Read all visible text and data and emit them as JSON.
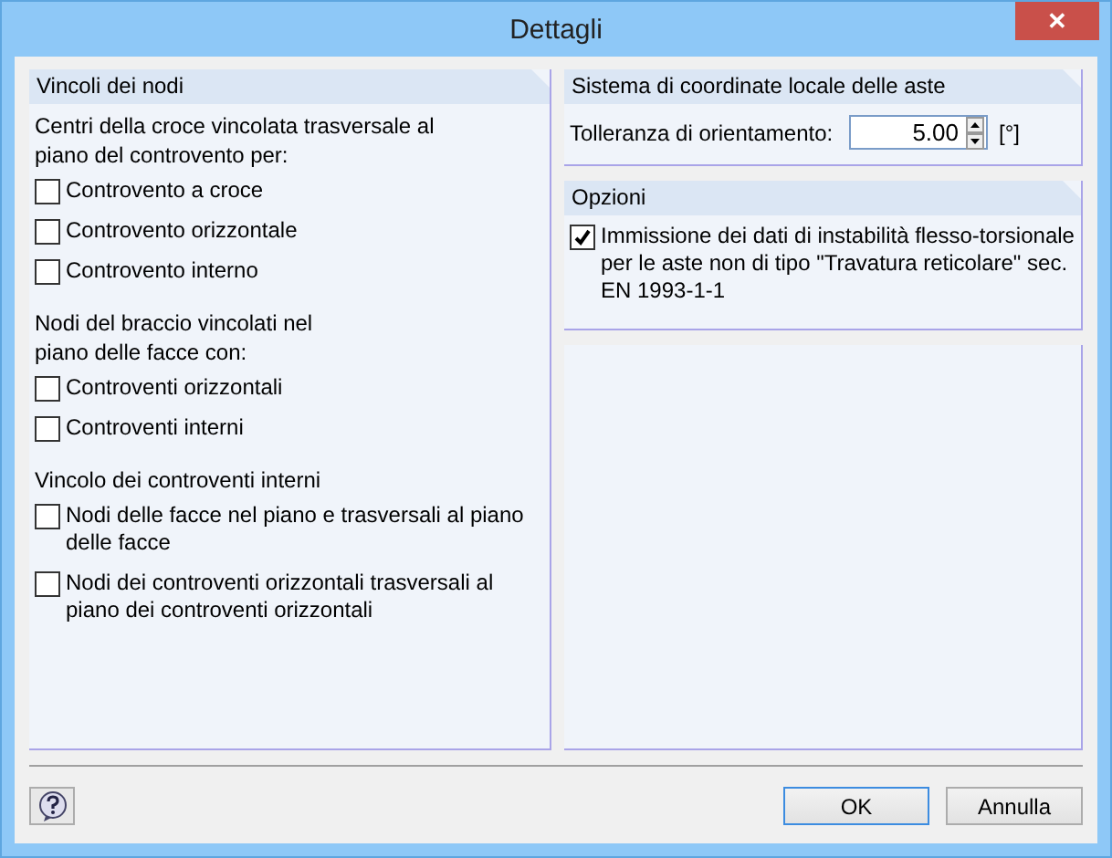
{
  "window": {
    "title": "Dettagli",
    "close": "✕"
  },
  "left_panel": {
    "title": "Vincoli dei nodi",
    "groups": [
      {
        "heading": "Centri della croce vincolata trasversale al piano del controvento per:",
        "items": [
          {
            "label": "Controvento a croce",
            "checked": false
          },
          {
            "label": "Controvento orizzontale",
            "checked": false
          },
          {
            "label": "Controvento interno",
            "checked": false
          }
        ]
      },
      {
        "heading": "Nodi del braccio vincolati nel piano delle facce con:",
        "items": [
          {
            "label": "Controventi orizzontali",
            "checked": false
          },
          {
            "label": "Controventi interni",
            "checked": false
          }
        ]
      },
      {
        "heading": "Vincolo dei controventi interni",
        "items": [
          {
            "label": "Nodi delle facce nel piano e trasversali al piano delle facce",
            "checked": false
          },
          {
            "label": "Nodi dei controventi orizzontali trasversali al piano dei controventi orizzontali",
            "checked": false
          }
        ]
      }
    ]
  },
  "coordinate_panel": {
    "title": "Sistema di coordinate locale delle aste",
    "label": "Tolleranza di orientamento:",
    "value": "5.00",
    "unit": "[°]"
  },
  "options_panel": {
    "title": "Opzioni",
    "items": [
      {
        "label": "Immissione dei dati di instabilità flesso-torsionale per le aste non di tipo \"Travatura reticolare\" sec. EN 1993-1-1",
        "checked": true
      }
    ]
  },
  "buttons": [
    {
      "label": "OK",
      "default": true
    },
    {
      "label": "Annulla",
      "default": false
    }
  ]
}
